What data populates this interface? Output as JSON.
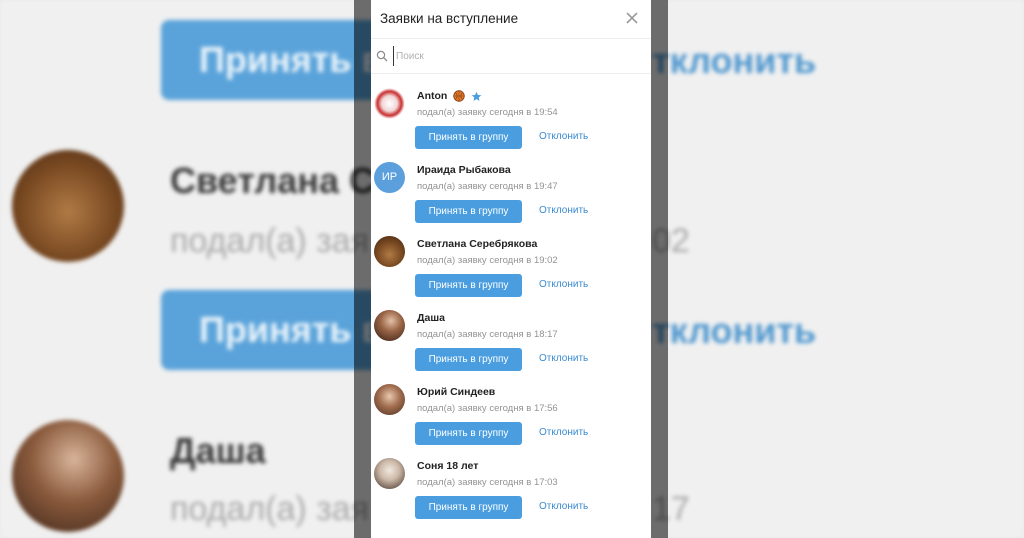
{
  "background": {
    "accept_label": "Принять в",
    "reject_label": "тклонить",
    "name_1": "Светлана С",
    "sub_1": "подал(а) зая",
    "time_1": "02",
    "name_2": "Даша",
    "sub_2": "подал(а) зая",
    "time_2": "17"
  },
  "modal": {
    "title": "Заявки на вступление",
    "search_placeholder": "Поиск",
    "requests": [
      {
        "name": "Anton",
        "status": "подал(а) заявку сегодня в 19:54",
        "accept": "Принять в группу",
        "reject": "Отклонить",
        "avatar": "photo-ring",
        "badge": "basketball-emoji",
        "verified": "star-icon"
      },
      {
        "name": "Ираида Рыбакова",
        "status": "подал(а) заявку сегодня в 19:47",
        "accept": "Принять в группу",
        "reject": "Отклонить",
        "avatar": "initials",
        "initials": "ИР"
      },
      {
        "name": "Светлана Серебрякова",
        "status": "подал(а) заявку сегодня в 19:02",
        "accept": "Принять в группу",
        "reject": "Отклонить",
        "avatar": "photo-brown"
      },
      {
        "name": "Даша",
        "status": "подал(а) заявку сегодня в 18:17",
        "accept": "Принять в группу",
        "reject": "Отклонить",
        "avatar": "photo-girl"
      },
      {
        "name": "Юрий Синдеев",
        "status": "подал(а) заявку сегодня в 17:56",
        "accept": "Принять в группу",
        "reject": "Отклонить",
        "avatar": "photo-girl-2"
      },
      {
        "name": "Соня 18 лет",
        "status": "подал(а) заявку сегодня в 17:03",
        "accept": "Принять в группу",
        "reject": "Отклонить",
        "avatar": "photo-girl-3"
      }
    ]
  },
  "colors": {
    "accent": "#4a9ee0",
    "link": "#3a8ad0",
    "muted_text": "#939393"
  }
}
